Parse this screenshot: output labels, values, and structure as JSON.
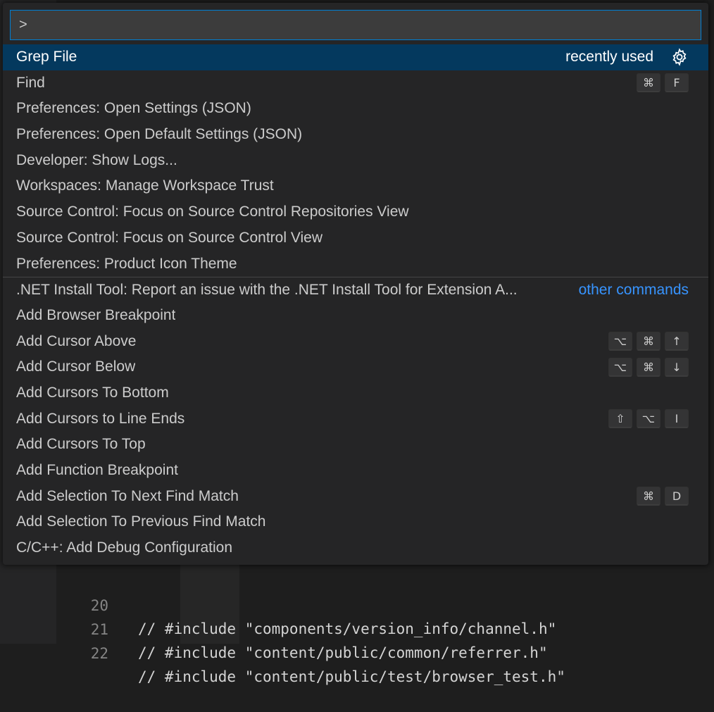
{
  "input": {
    "value": ">",
    "placeholder": ""
  },
  "items": [
    {
      "label": "Grep File",
      "description": "recently used",
      "selected": true,
      "gear": true,
      "keys": []
    },
    {
      "label": "Find",
      "keys": [
        "⌘",
        "F"
      ]
    },
    {
      "label": "Preferences: Open Settings (JSON)",
      "keys": []
    },
    {
      "label": "Preferences: Open Default Settings (JSON)",
      "keys": []
    },
    {
      "label": "Developer: Show Logs...",
      "keys": []
    },
    {
      "label": "Workspaces: Manage Workspace Trust",
      "keys": []
    },
    {
      "label": "Source Control: Focus on Source Control Repositories View",
      "keys": []
    },
    {
      "label": "Source Control: Focus on Source Control View",
      "keys": []
    },
    {
      "label": "Preferences: Product Icon Theme",
      "keys": []
    },
    {
      "label": ".NET Install Tool: Report an issue with the .NET Install Tool for Extension A...",
      "link": "other commands",
      "separator": true,
      "keys": []
    },
    {
      "label": "Add Browser Breakpoint",
      "keys": []
    },
    {
      "label": "Add Cursor Above",
      "keys": [
        "⌥",
        "⌘",
        "↑"
      ]
    },
    {
      "label": "Add Cursor Below",
      "keys": [
        "⌥",
        "⌘",
        "↓"
      ]
    },
    {
      "label": "Add Cursors To Bottom",
      "keys": []
    },
    {
      "label": "Add Cursors to Line Ends",
      "keys": [
        "⇧",
        "⌥",
        "I"
      ]
    },
    {
      "label": "Add Cursors To Top",
      "keys": []
    },
    {
      "label": "Add Function Breakpoint",
      "keys": []
    },
    {
      "label": "Add Selection To Next Find Match",
      "keys": [
        "⌘",
        "D"
      ]
    },
    {
      "label": "Add Selection To Previous Find Match",
      "keys": []
    },
    {
      "label": "C/C++: Add Debug Configuration",
      "keys": []
    }
  ],
  "code": [
    {
      "line": "20",
      "text": "// #include \"components/version_info/channel.h\""
    },
    {
      "line": "21",
      "text": "// #include \"content/public/common/referrer.h\""
    },
    {
      "line": "22",
      "text": "// #include \"content/public/test/browser_test.h\""
    }
  ],
  "colors": {
    "accent": "#007fd4",
    "selection": "#04395e",
    "link": "#3794ff",
    "background": "#252526"
  },
  "icons": {
    "gear": "gear-icon"
  }
}
